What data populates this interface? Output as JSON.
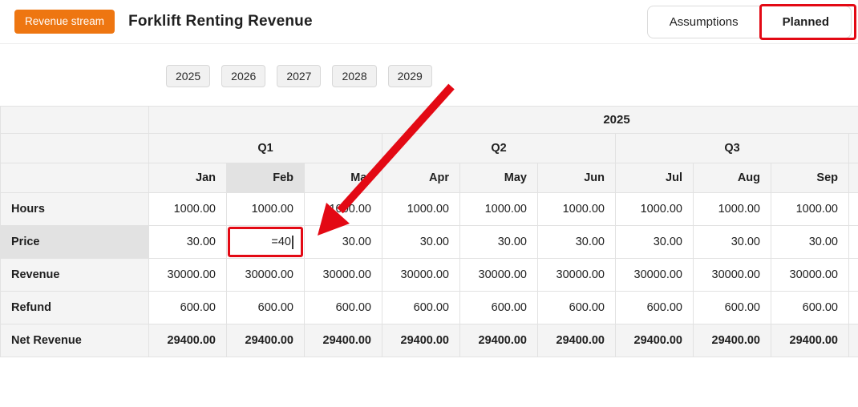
{
  "colors": {
    "accent_orange": "#ee7611",
    "annotation_red": "#e30914",
    "header_bg": "#f4f4f4",
    "highlight_bg": "#e2e2e2",
    "border": "#e2e2e2"
  },
  "header": {
    "badge_label": "Revenue stream",
    "title": "Forklift Renting Revenue",
    "assumptions_label": "Assumptions",
    "planned_label": "Planned"
  },
  "year_tabs": {
    "items": [
      "2025",
      "2026",
      "2027",
      "2028",
      "2029"
    ]
  },
  "table": {
    "year_header": "2025",
    "quarters": [
      {
        "label": "Q1",
        "span": 3
      },
      {
        "label": "Q2",
        "span": 3
      },
      {
        "label": "Q3",
        "span": 3
      }
    ],
    "months": [
      "Jan",
      "Feb",
      "Mar",
      "Apr",
      "May",
      "Jun",
      "Jul",
      "Aug",
      "Sep"
    ],
    "highlight_month_index": 1,
    "rows": [
      {
        "label": "Hours",
        "values": [
          "1000.00",
          "1000.00",
          "1000.00",
          "1000.00",
          "1000.00",
          "1000.00",
          "1000.00",
          "1000.00",
          "1000.00"
        ]
      },
      {
        "label": "Price",
        "values": [
          "30.00",
          "",
          "30.00",
          "30.00",
          "30.00",
          "30.00",
          "30.00",
          "30.00",
          "30.00"
        ],
        "editing": {
          "col": 1,
          "value": "=40"
        }
      },
      {
        "label": "Revenue",
        "values": [
          "30000.00",
          "30000.00",
          "30000.00",
          "30000.00",
          "30000.00",
          "30000.00",
          "30000.00",
          "30000.00",
          "30000.00"
        ]
      },
      {
        "label": "Refund",
        "values": [
          "600.00",
          "600.00",
          "600.00",
          "600.00",
          "600.00",
          "600.00",
          "600.00",
          "600.00",
          "600.00"
        ]
      },
      {
        "label": "Net Revenue",
        "emphasis": true,
        "values": [
          "29400.00",
          "29400.00",
          "29400.00",
          "29400.00",
          "29400.00",
          "29400.00",
          "29400.00",
          "29400.00",
          "29400.00"
        ]
      }
    ]
  }
}
